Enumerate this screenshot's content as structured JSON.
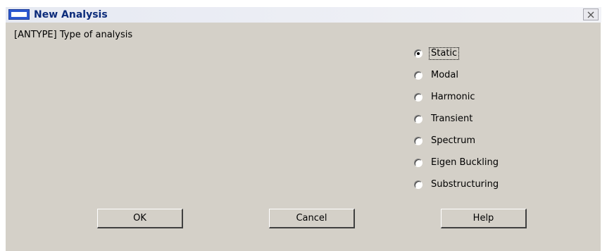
{
  "window": {
    "title": "New Analysis",
    "close_glyph": "✕"
  },
  "prompt": {
    "label": "[ANTYPE]  Type of analysis"
  },
  "analysis_types": {
    "selected": "Static",
    "options": [
      "Static",
      "Modal",
      "Harmonic",
      "Transient",
      "Spectrum",
      "Eigen Buckling",
      "Substructuring"
    ]
  },
  "buttons": {
    "ok": "OK",
    "cancel": "Cancel",
    "help": "Help"
  },
  "icons": {
    "title_icon": "window-icon",
    "close_icon": "close-icon"
  },
  "colors": {
    "dialog_bg": "#d4d0c8",
    "title_text": "#0b2b7a",
    "title_icon": "#2c58cf"
  }
}
